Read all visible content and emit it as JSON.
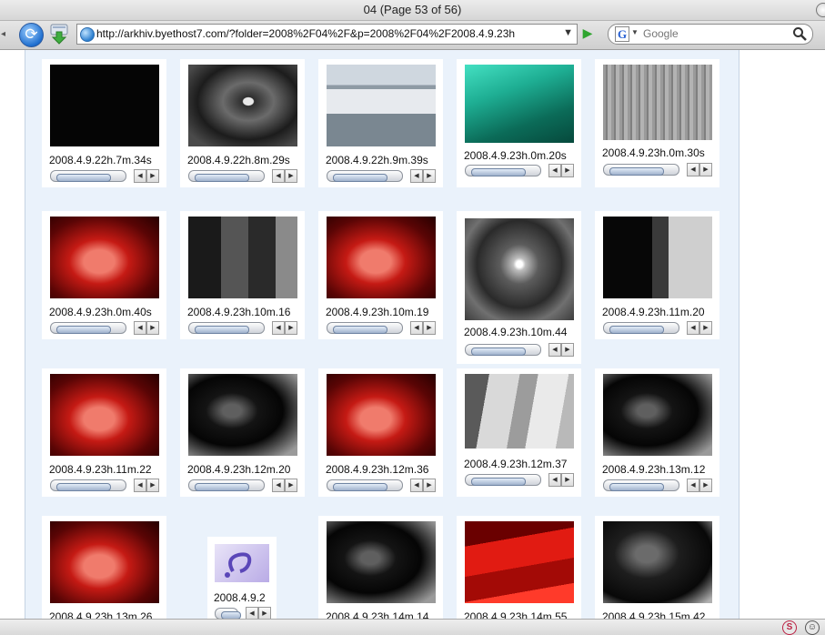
{
  "window": {
    "title": "04 (Page 53 of 56)"
  },
  "toolbar": {
    "url": "http://arkhiv.byethost7.com/?folder=2008%2F04%2F&p=2008%2F04%2F2008.4.9.23h",
    "search_placeholder": "Google",
    "search_engine_letter": "G"
  },
  "gallery": {
    "items": [
      {
        "caption": "2008.4.9.22h.7m.34s",
        "image": "black-frame"
      },
      {
        "caption": "2008.4.9.22h.8m.29s",
        "image": "seagull-on-rocks"
      },
      {
        "caption": "2008.4.9.22h.9m.39s",
        "image": "office-worker-at-computer"
      },
      {
        "caption": "2008.4.9.23h.0m.20s",
        "image": "green-office-room"
      },
      {
        "caption": "2008.4.9.23h.0m.30s",
        "image": "grey-forest"
      },
      {
        "caption": "2008.4.9.23h.0m.40s",
        "image": "red-woman-face"
      },
      {
        "caption": "2008.4.9.23h.10m.16",
        "image": "dark-figure-shadow"
      },
      {
        "caption": "2008.4.9.23h.10m.19",
        "image": "red-woman-face"
      },
      {
        "caption": "2008.4.9.23h.10m.44",
        "image": "night-road-lights"
      },
      {
        "caption": "2008.4.9.23h.11m.20",
        "image": "dark-door"
      },
      {
        "caption": "2008.4.9.23h.11m.22",
        "image": "red-woman-face"
      },
      {
        "caption": "2008.4.9.23h.12m.20",
        "image": "dark-man-face"
      },
      {
        "caption": "2008.4.9.23h.12m.36",
        "image": "red-woman-face"
      },
      {
        "caption": "2008.4.9.23h.12m.37",
        "image": "grey-room-doors"
      },
      {
        "caption": "2008.4.9.23h.13m.12",
        "image": "dark-man-face"
      },
      {
        "caption": "2008.4.9.23h.13m.26",
        "image": "red-woman-face"
      },
      {
        "caption": "2008.4.9.2",
        "image": "missing-plugin-placeholder"
      },
      {
        "caption": "2008.4.9.23h.14m.14",
        "image": "dark-man-face"
      },
      {
        "caption": "2008.4.9.23h.14m.55",
        "image": "red-room"
      },
      {
        "caption": "2008.4.9.23h.15m.42",
        "image": "dark-figure-room"
      }
    ]
  },
  "status": {
    "icons": [
      "s-icon",
      "face-icon"
    ]
  }
}
